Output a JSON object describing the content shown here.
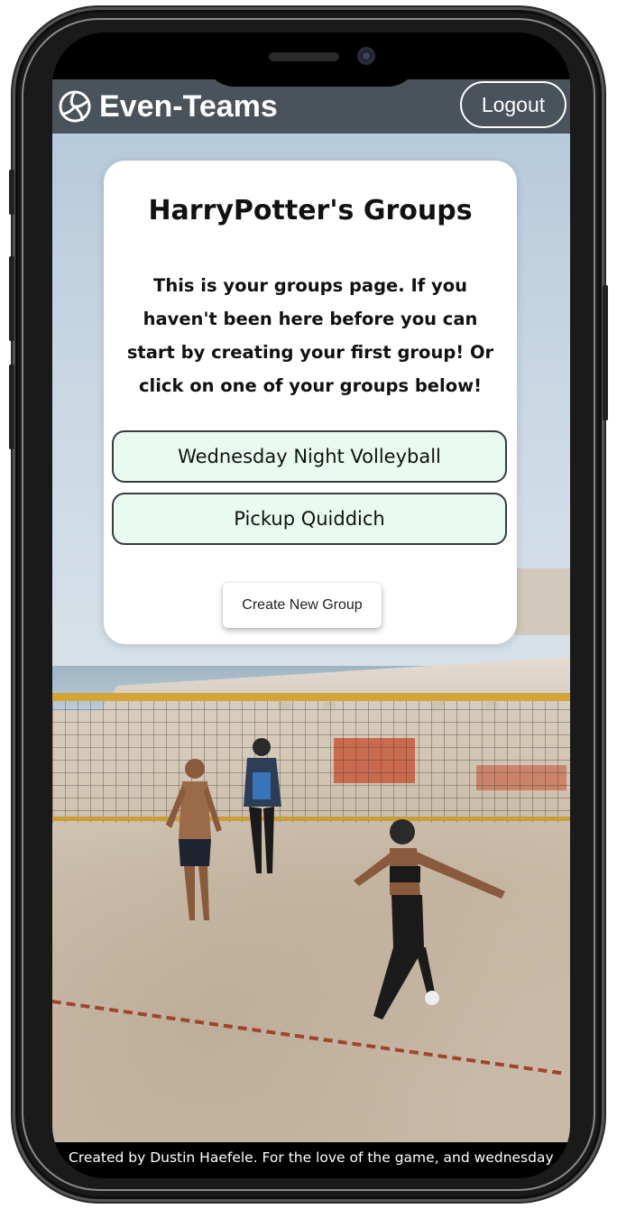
{
  "header": {
    "brand": "Even-Teams",
    "logout_label": "Logout"
  },
  "card": {
    "title": "HarryPotter's Groups",
    "description": "This is your groups page. If you haven't been here before you can start by creating your first group! Or click on one of your groups below!",
    "groups": [
      {
        "label": "Wednesday Night Volleyball"
      },
      {
        "label": "Pickup Quiddich"
      }
    ],
    "create_label": "Create New Group"
  },
  "footer": {
    "text": "Created by Dustin Haefele. For the love of the game, and wednesday"
  },
  "icons": {
    "brand_icon": "volleyball-icon"
  },
  "colors": {
    "header_bg": "#4a525b",
    "group_button_bg": "#e9fbf0",
    "footer_bg": "#000000"
  }
}
